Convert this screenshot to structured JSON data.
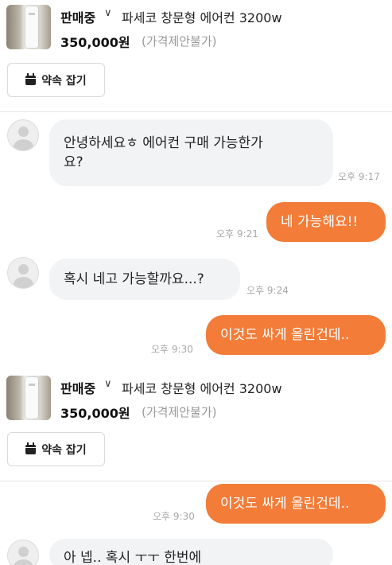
{
  "product": {
    "status": "판매중",
    "chevron": "∨",
    "title": "파세코 창문형 에어컨 3200w",
    "price": "350,000원",
    "price_note": "(가격제안불가)"
  },
  "appointment_button": {
    "label": "약속 잡기"
  },
  "messages": [
    {
      "side": "in",
      "text": "안녕하세요ㅎ 에어컨 구매 가능한가요?",
      "line1": "안녕하세요ㅎ 에어컨 구매 가능한가",
      "line2": "요?",
      "time": "오후 9:17"
    },
    {
      "side": "out",
      "text": "네 가능해요!!",
      "time": "오후 9:21"
    },
    {
      "side": "in",
      "text": "혹시 네고 가능할까요...?",
      "time": "오후 9:24"
    },
    {
      "side": "out",
      "text": "이것도 싸게 올린건데..",
      "time": "오후 9:30"
    }
  ],
  "repeat": {
    "product": {
      "status": "판매중",
      "chevron": "∨",
      "title": "파세코 창문형 에어컨 3200w",
      "price": "350,000원",
      "price_note": "(가격제안불가)"
    },
    "appointment_button": {
      "label": "약속 잡기"
    },
    "messages": [
      {
        "side": "out",
        "text": "이것도 싸게 올린건데..",
        "time": "오후 9:30"
      },
      {
        "side": "in",
        "text": "아 넵.. 혹시 ㅜㅜ 한번에"
      }
    ]
  },
  "colors": {
    "outgoing_bubble": "#f27c38",
    "incoming_bubble": "#f2f3f5",
    "time_text": "#a8a8a8"
  },
  "icons": {
    "calendar": "calendar-icon",
    "avatar": "avatar-icon",
    "chevron": "chevron-down-icon"
  }
}
